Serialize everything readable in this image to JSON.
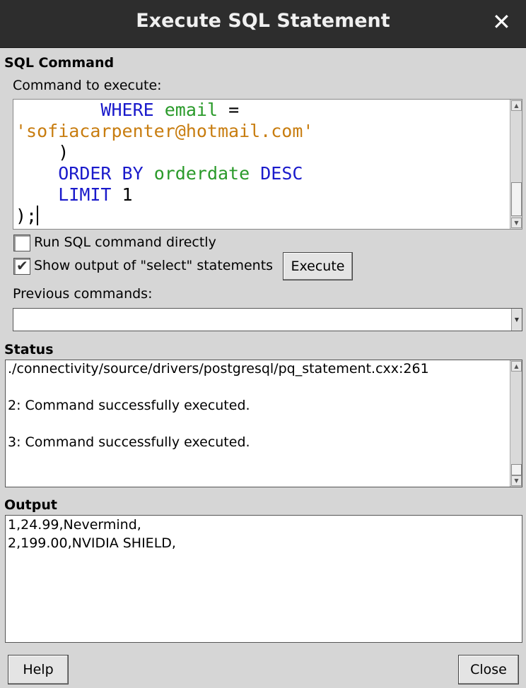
{
  "window": {
    "title": "Execute SQL Statement"
  },
  "sql_command": {
    "section_label": "SQL Command",
    "command_label": "Command to execute:",
    "code_lines": {
      "l1_kw": "WHERE",
      "l1_id": "email",
      "l1_op": "=",
      "l2_str": "'sofiacarpenter@hotmail.com'",
      "l3": ")",
      "l4_kw1": "ORDER BY",
      "l4_id": "orderdate",
      "l4_kw2": "DESC",
      "l5_kw": "LIMIT",
      "l5_num": "1",
      "l6": ");"
    },
    "run_directly_label": "Run SQL command directly",
    "run_directly_checked": false,
    "show_output_label": "Show output of \"select\" statements",
    "show_output_checked": true,
    "execute_button": "Execute",
    "previous_label": "Previous commands:",
    "previous_value": ""
  },
  "status": {
    "section_label": "Status",
    "lines": [
      "./connectivity/source/drivers/postgresql/pq_statement.cxx:261",
      "",
      "2: Command successfully executed.",
      "",
      "3: Command successfully executed."
    ]
  },
  "output": {
    "section_label": "Output",
    "lines": [
      "1,24.99,Nevermind,",
      "2,199.00,NVIDIA SHIELD,"
    ]
  },
  "footer": {
    "help_button": "Help",
    "close_button": "Close"
  },
  "icons": {
    "close": "close-icon",
    "scroll_up": "scroll-up-arrow-icon",
    "scroll_down": "scroll-down-arrow-icon",
    "dropdown": "chevron-down-icon",
    "check": "checkmark-icon"
  }
}
